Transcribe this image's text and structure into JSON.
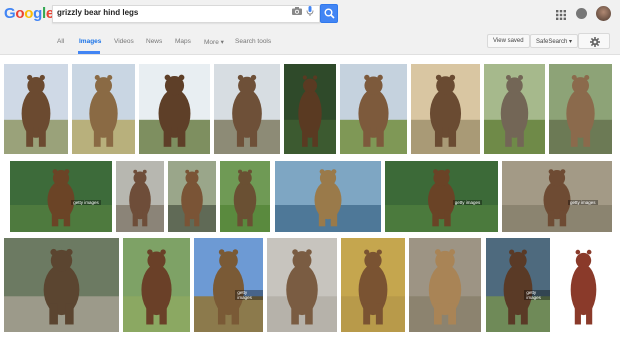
{
  "logo": {
    "letters": [
      "G",
      "o",
      "o",
      "g",
      "l",
      "e"
    ],
    "colors": [
      "#4285f4",
      "#ea4335",
      "#fbbc05",
      "#4285f4",
      "#34a853",
      "#ea4335"
    ]
  },
  "search": {
    "query": "grizzly bear hind legs"
  },
  "tabs": [
    {
      "label": "All"
    },
    {
      "label": "Images"
    },
    {
      "label": "Videos"
    },
    {
      "label": "News"
    },
    {
      "label": "Maps"
    },
    {
      "label": "More ▾"
    },
    {
      "label": "Search tools"
    }
  ],
  "toolbar": {
    "view_saved": "View saved",
    "safesearch": "SafeSearch ▾"
  },
  "colors": {
    "accent": "#4285f4",
    "header_bg": "#f1f1f1"
  },
  "results": [
    {
      "badge": "",
      "sky": "#cfd9e6",
      "ground": "#9aa27a",
      "bear": "#6b4a30"
    },
    {
      "badge": "",
      "sky": "#c9d6e3",
      "ground": "#b8b07c",
      "bear": "#8a6a44"
    },
    {
      "badge": "",
      "sky": "#e8eef2",
      "ground": "#7e8f60",
      "bear": "#5e3f28"
    },
    {
      "badge": "",
      "sky": "#d7dde2",
      "ground": "#8d8b76",
      "bear": "#6e5038"
    },
    {
      "badge": "",
      "sky": "#2f4a2a",
      "ground": "#3c5a30",
      "bear": "#5a3a22"
    },
    {
      "badge": "",
      "sky": "#c5d2de",
      "ground": "#7f9856",
      "bear": "#7d5a3c"
    },
    {
      "badge": "",
      "sky": "#d9c6a2",
      "ground": "#a99a76",
      "bear": "#6a4b32"
    },
    {
      "badge": "",
      "sky": "#a6b98c",
      "ground": "#6f8a48",
      "bear": "#736656"
    },
    {
      "badge": "",
      "sky": "#8da377",
      "ground": "#6c7a55",
      "bear": "#8b6a4c"
    },
    {
      "badge": "getty images",
      "sky": "#3d6b3a",
      "ground": "#4e7a3e",
      "bear": "#6b4426"
    },
    {
      "badge": "",
      "sky": "#b7b7b0",
      "ground": "#8b8478",
      "bear": "#6e4d39"
    },
    {
      "badge": "",
      "sky": "#9aa68a",
      "ground": "#606a56",
      "bear": "#7a5436"
    },
    {
      "badge": "",
      "sky": "#6f9a55",
      "ground": "#5a8a3e",
      "bear": "#6a5033"
    },
    {
      "badge": "",
      "sky": "#7ea6c3",
      "ground": "#4e7898",
      "bear": "#9a7a4a"
    },
    {
      "badge": "getty images",
      "sky": "#3c6a38",
      "ground": "#4b7a3d",
      "bear": "#6a4326"
    },
    {
      "badge": "getty images",
      "sky": "#a39a86",
      "ground": "#8b8470",
      "bear": "#6e4b33"
    },
    {
      "badge": "",
      "sky": "#6c7a62",
      "ground": "#9c9a8a",
      "bear": "#5b4530"
    },
    {
      "badge": "",
      "sky": "#7ea266",
      "ground": "#8ba862",
      "bear": "#6a4028"
    },
    {
      "badge": "getty images",
      "sky": "#6d9ad4",
      "ground": "#8c7a4c",
      "bear": "#7a5a36"
    },
    {
      "badge": "",
      "sky": "#c7c4be",
      "ground": "#b6b2aa",
      "bear": "#7a5c42"
    },
    {
      "badge": "",
      "sky": "#c5a64e",
      "ground": "#b89a4a",
      "bear": "#7a5332"
    },
    {
      "badge": "",
      "sky": "#9d9484",
      "ground": "#8c836f",
      "bear": "#a98456"
    },
    {
      "badge": "getty images",
      "sky": "#4e6a7e",
      "ground": "#6f8a58",
      "bear": "#5a3a26"
    },
    {
      "badge": "",
      "sky": "#ffffff",
      "ground": "#ffffff",
      "bear": "#8a3a2a"
    }
  ]
}
